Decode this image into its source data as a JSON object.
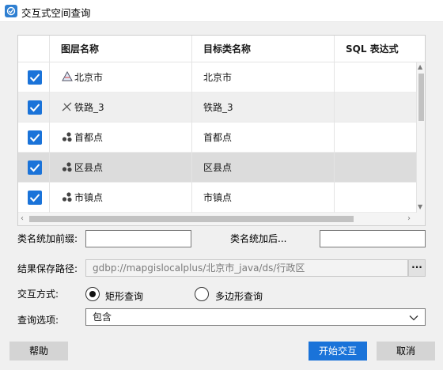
{
  "window": {
    "title": "交互式空间查询"
  },
  "table": {
    "columns": [
      "",
      "图层名称",
      "目标类名称",
      "SQL 表达式"
    ],
    "rows": [
      {
        "checked": true,
        "layer": "北京市",
        "target": "北京市",
        "sql": "",
        "icon": "polygon-layer-icon"
      },
      {
        "checked": true,
        "layer": "铁路_3",
        "target": "铁路_3",
        "sql": "",
        "icon": "line-layer-icon"
      },
      {
        "checked": true,
        "layer": "首都点",
        "target": "首都点",
        "sql": "",
        "icon": "point-layer-icon"
      },
      {
        "checked": true,
        "layer": "区县点",
        "target": "区县点",
        "sql": "",
        "icon": "point-layer-icon"
      },
      {
        "checked": true,
        "layer": "市镇点",
        "target": "市镇点",
        "sql": "",
        "icon": "point-layer-icon"
      }
    ]
  },
  "form": {
    "prefix_label": "类名统加前缀:",
    "prefix_value": "",
    "suffix_label": "类名统加后...",
    "suffix_value": "",
    "save_path_label": "结果保存路径:",
    "save_path_value": "gdbp://mapgislocalplus/北京市_java/ds/行政区",
    "browse_label": "···",
    "mode_label": "交互方式:",
    "mode_options": [
      "矩形查询",
      "多边形查询"
    ],
    "mode_selected": "矩形查询",
    "query_label": "查询选项:",
    "query_value": "包含"
  },
  "buttons": {
    "help": "帮助",
    "start": "开始交互",
    "cancel": "取消"
  },
  "colors": {
    "accent": "#1a73d9",
    "title_icon": "#2f7fd1"
  }
}
